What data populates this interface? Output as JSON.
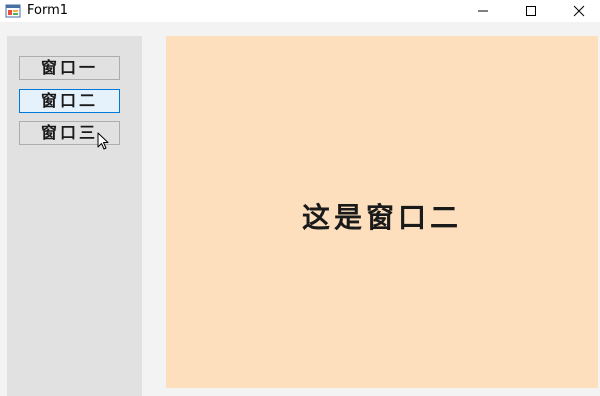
{
  "window": {
    "title": "Form1",
    "controls": {
      "minimize": "minimize",
      "maximize": "maximize",
      "close": "close"
    }
  },
  "sidebar": {
    "buttons": [
      {
        "label": "窗口一",
        "active": false
      },
      {
        "label": "窗口二",
        "active": true
      },
      {
        "label": "窗口三",
        "active": false
      }
    ]
  },
  "content": {
    "text": "这是窗口二",
    "background": "#fddfbd"
  },
  "colors": {
    "active_border": "#0078d7",
    "active_fill": "#e5f1fb",
    "sidebar_bg": "#e1e1e1"
  },
  "icons": [
    "app-form-icon",
    "minimize-icon",
    "maximize-icon",
    "close-icon",
    "mouse-pointer-icon"
  ]
}
